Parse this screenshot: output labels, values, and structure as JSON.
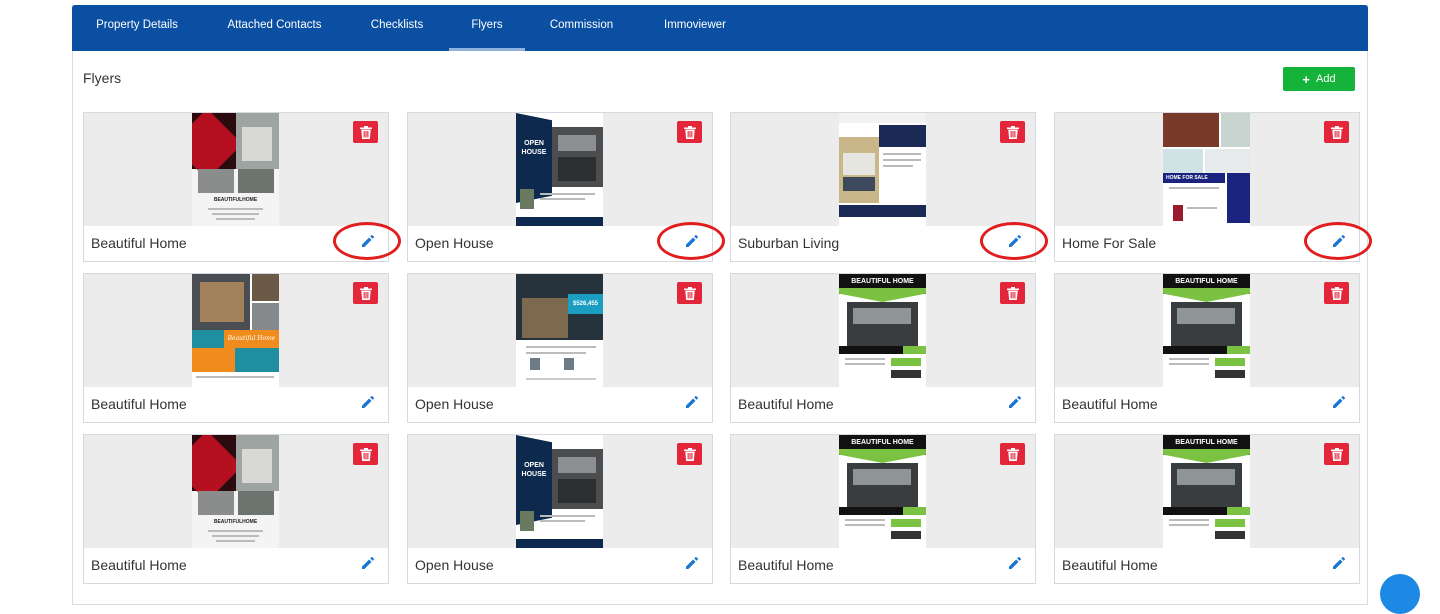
{
  "tabs": [
    {
      "label": "Property Details"
    },
    {
      "label": "Attached Contacts"
    },
    {
      "label": "Checklists"
    },
    {
      "label": "Flyers"
    },
    {
      "label": "Commission"
    },
    {
      "label": "Immoviewer"
    }
  ],
  "active_tab": "Flyers",
  "section": {
    "title": "Flyers"
  },
  "add_button": {
    "label": "Add",
    "icon": "plus-icon"
  },
  "colors": {
    "tab_bar": "#0a4fa2",
    "add": "#15b33a",
    "delete": "#e3263a",
    "edit": "#1976d2",
    "highlight": "#e11d1d"
  },
  "flyers": [
    {
      "title": "Beautiful Home",
      "style": "red-diamond",
      "thumb_text": "BEAUTIFULHOME"
    },
    {
      "title": "Open House",
      "style": "open-house",
      "thumb_text": "OPEN HOUSE"
    },
    {
      "title": "Suburban Living",
      "style": "suburban",
      "thumb_text": ""
    },
    {
      "title": "Home For Sale",
      "style": "for-sale",
      "thumb_text": "HOME FOR SALE"
    },
    {
      "title": "Beautiful Home",
      "style": "orange-teal",
      "thumb_text": "Beautiful Home"
    },
    {
      "title": "Open House",
      "style": "price-card",
      "thumb_text": "$526,455"
    },
    {
      "title": "Beautiful Home",
      "style": "green-banner",
      "thumb_text": "BEAUTIFUL HOME"
    },
    {
      "title": "Beautiful Home",
      "style": "green-banner",
      "thumb_text": "BEAUTIFUL HOME"
    },
    {
      "title": "Beautiful Home",
      "style": "red-diamond",
      "thumb_text": "BEAUTIFULHOME"
    },
    {
      "title": "Open House",
      "style": "open-house",
      "thumb_text": "OPEN HOUSE"
    },
    {
      "title": "Beautiful Home",
      "style": "green-banner",
      "thumb_text": "BEAUTIFUL HOME"
    },
    {
      "title": "Beautiful Home",
      "style": "green-banner",
      "thumb_text": "BEAUTIFUL HOME"
    }
  ],
  "highlighted_edit_buttons": [
    0,
    1,
    2,
    3
  ]
}
